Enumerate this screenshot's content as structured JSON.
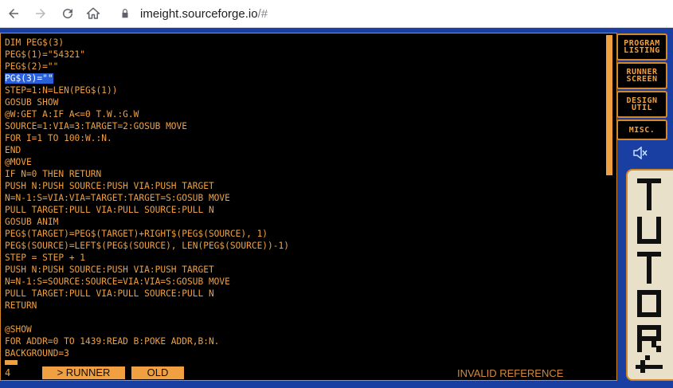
{
  "browser": {
    "url_host": "imeight.sourceforge.io",
    "url_path": "/#"
  },
  "listing": [
    {
      "text": "DIM PEG$(3)",
      "selected": false
    },
    {
      "text": "PEG$(1)=\"54321\"",
      "selected": false
    },
    {
      "text": "PEG$(2)=\"\"",
      "selected": false
    },
    {
      "text": "PG$(3)=\"\"",
      "selected": true
    },
    {
      "text": "STEP=1:N=LEN(PEG$(1))",
      "selected": false
    },
    {
      "text": "GOSUB SHOW",
      "selected": false
    },
    {
      "text": "@W:GET A:IF A<=0 T.W.:G.W",
      "selected": false
    },
    {
      "text": "SOURCE=1:VIA=3:TARGET=2:GOSUB MOVE",
      "selected": false
    },
    {
      "text": "FOR I=1 TO 100:W.:N.",
      "selected": false
    },
    {
      "text": "END",
      "selected": false
    },
    {
      "text": "@MOVE",
      "selected": false
    },
    {
      "text": "IF N=0 THEN RETURN",
      "selected": false
    },
    {
      "text": "PUSH N:PUSH SOURCE:PUSH VIA:PUSH TARGET",
      "selected": false
    },
    {
      "text": "N=N-1:S=VIA:VIA=TARGET:TARGET=S:GOSUB MOVE",
      "selected": false
    },
    {
      "text": "PULL TARGET:PULL VIA:PULL SOURCE:PULL N",
      "selected": false
    },
    {
      "text": "GOSUB ANIM",
      "selected": false
    },
    {
      "text": "PEG$(TARGET)=PEG$(TARGET)+RIGHT$(PEG$(SOURCE), 1)",
      "selected": false
    },
    {
      "text": "PEG$(SOURCE)=LEFT$(PEG$(SOURCE), LEN(PEG$(SOURCE))-1)",
      "selected": false
    },
    {
      "text": "STEP = STEP + 1",
      "selected": false
    },
    {
      "text": "PUSH N:PUSH SOURCE:PUSH VIA:PUSH TARGET",
      "selected": false
    },
    {
      "text": "N=N-1:S=SOURCE:SOURCE=VIA:VIA=S:GOSUB MOVE",
      "selected": false
    },
    {
      "text": "PULL TARGET:PULL VIA:PULL SOURCE:PULL N",
      "selected": false
    },
    {
      "text": "RETURN",
      "selected": false
    },
    {
      "text": "",
      "selected": false
    },
    {
      "text": "@SHOW",
      "selected": false
    },
    {
      "text": "FOR ADDR=0 TO 1439:READ B:POKE ADDR,B:N.",
      "selected": false
    },
    {
      "text": "BACKGROUND=3",
      "selected": false
    }
  ],
  "status": {
    "line_number": "4",
    "runner_label": "> RUNNER",
    "old_label": "OLD",
    "message": "INVALID REFERENCE"
  },
  "menu": {
    "program_listing": [
      "PROGRAM",
      "LISTING"
    ],
    "runner_screen": [
      "RUNNER",
      "SCREEN"
    ],
    "design_util": [
      "DESIGN",
      "UTIL"
    ],
    "misc": [
      "MISC."
    ]
  },
  "tutor_label": "TUTOR",
  "colors": {
    "text": "#f0a040",
    "selection": "#2a60d8",
    "background": "#1a3fa3"
  },
  "icons": [
    "back-icon",
    "forward-icon",
    "reload-icon",
    "home-icon",
    "lock-icon",
    "speaker-muted-icon"
  ]
}
